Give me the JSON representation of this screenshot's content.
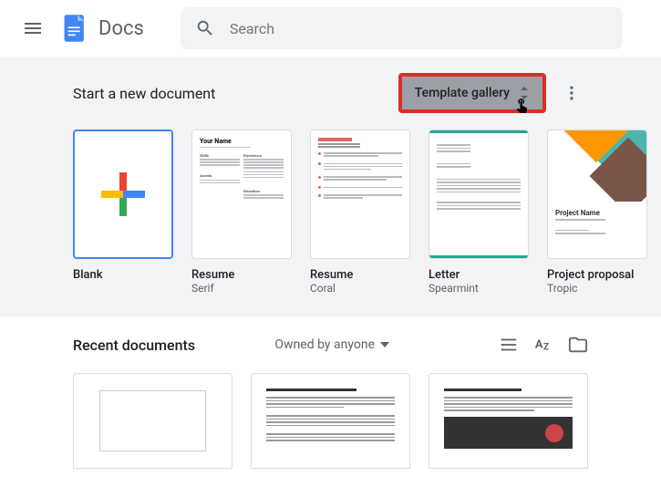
{
  "header": {
    "app_name": "Docs",
    "search_placeholder": "Search"
  },
  "templates": {
    "section_title": "Start a new document",
    "gallery_button": "Template gallery",
    "items": [
      {
        "name": "Blank",
        "sub": ""
      },
      {
        "name": "Resume",
        "sub": "Serif"
      },
      {
        "name": "Resume",
        "sub": "Coral"
      },
      {
        "name": "Letter",
        "sub": "Spearmint"
      },
      {
        "name": "Project proposal",
        "sub": "Tropic"
      }
    ],
    "resume_preview_name": "Your Name"
  },
  "proposal_preview_title": "Project Name",
  "recent": {
    "section_title": "Recent documents",
    "owned_by_label": "Owned by anyone"
  }
}
